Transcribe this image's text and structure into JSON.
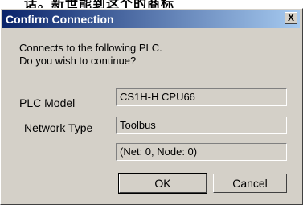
{
  "background_text": "话。新世能到这个的商标",
  "dialog": {
    "title": "Confirm Connection",
    "close_label": "X",
    "message_line1": "Connects to the following PLC.",
    "message_line2": "Do you wish to continue?",
    "plc_model_label": "PLC Model",
    "plc_model_value": "CS1H-H CPU66",
    "network_type_label": "Network Type",
    "network_type_value": "Toolbus",
    "address_value": "(Net: 0, Node: 0)",
    "ok_label": "OK",
    "cancel_label": "Cancel"
  },
  "colors": {
    "title_bar_start": "#0a246a",
    "title_bar_end": "#a6caf0",
    "dialog_face": "#d4d0c8"
  }
}
